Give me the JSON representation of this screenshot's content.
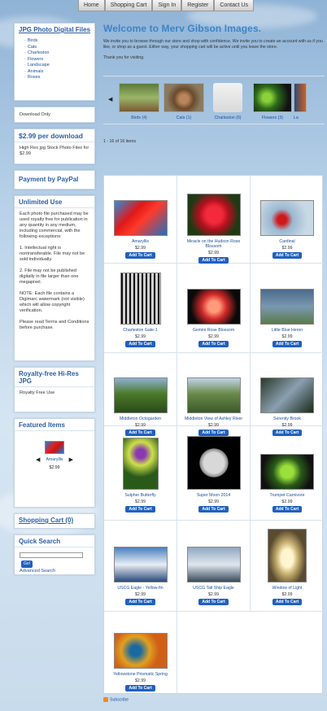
{
  "nav": [
    "Home",
    "Shopping Cart",
    "Sign In",
    "Register",
    "Contact Us"
  ],
  "sidebar": {
    "categories_title": "JPG Photo Digital Files",
    "categories": [
      "Birds",
      "Cats",
      "Charleston",
      "Flowers",
      "Landscape",
      "Animals",
      "Roses"
    ],
    "download_only": "Download Only",
    "price_title": "$2.99 per download",
    "price_desc": "High Res jpg Stock Photo Files for $2.99",
    "paypal_title": "Payment by PayPal",
    "unlimited_title": "Unlimited Use",
    "unlimited_text": "Each photo file purchased may be used royalty free for publication in any quantity in any medium, including commercial, with the following exceptions:",
    "rule1": "1. Intellectual right is nontransferable. File may not be sold individually.",
    "rule2": "2. File may not be published digitally in file larger than one megapixel.",
    "note": "NOTE: Each file contains a Digimarc watermark (not visible) which will allow copyright verification.",
    "terms": "Please read Terms and Conditions before purchase.",
    "royalty_title": "Royalty-free Hi-Res JPG",
    "royalty_text": "Royalty Free Use",
    "featured_title": "Featured Items",
    "featured_name": "Amaryllis",
    "featured_price": "$2.99",
    "cart_title": "Shopping Cart (0)",
    "search_title": "Quick Search",
    "search_go": "Go!",
    "advanced": "Advanced Search"
  },
  "main": {
    "title": "Welcome to Merv Gibson Images.",
    "intro1": "We invite you to browse through our store and shop with confidence. We invite you to create an account with us if you like, or shop as a guest. Either way, your shopping cart will be active until you leave the store.",
    "intro2": "Thank you for visiting.",
    "carousel": [
      "Birds (4)",
      "Cats (1)",
      "Charleston (6)",
      "Flowers (3)",
      "La"
    ],
    "count": "1 - 16 of 16 items",
    "products": [
      {
        "name": "Amaryllis",
        "price": "$2.99"
      },
      {
        "name": "Miracle on the Hudson Rose Blossom",
        "price": "$2.99"
      },
      {
        "name": "Cardinal",
        "price": "$2.99"
      },
      {
        "name": "Charleston Gate-1",
        "price": "$2.99"
      },
      {
        "name": "Gemini Rose Blossom",
        "price": "$2.99"
      },
      {
        "name": "Little Blue Heron",
        "price": "$2.99"
      },
      {
        "name": "Middleton Octogarden",
        "price": "$2.99"
      },
      {
        "name": "Middleton View of Ashley River",
        "price": "$2.99"
      },
      {
        "name": "Serenity Brook",
        "price": "$2.99"
      },
      {
        "name": "Sulpher Butterfly",
        "price": "$2.99"
      },
      {
        "name": "Super Moon 2014",
        "price": "$2.99"
      },
      {
        "name": "Trumpet Carnivore",
        "price": "$2.99"
      },
      {
        "name": "USCG Eagle - Yellow-fin",
        "price": "$2.99"
      },
      {
        "name": "USCG Tall Ship Eagle",
        "price": "$2.99"
      },
      {
        "name": "Window of Light",
        "price": "$2.99"
      },
      {
        "name": "Yellowstone Prismatic Spring",
        "price": "$2.99"
      }
    ],
    "add_to_cart": "Add To Cart"
  },
  "footer": {
    "subscribe": "Subscribe"
  }
}
